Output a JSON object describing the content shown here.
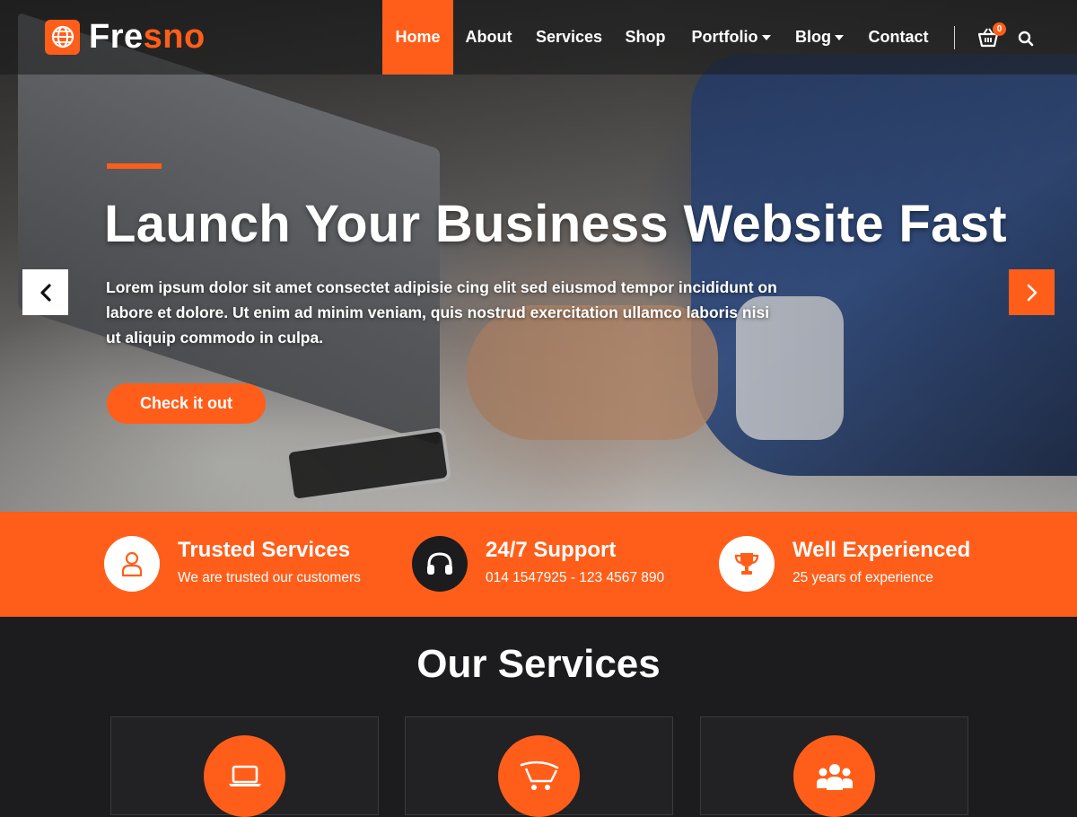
{
  "brand": {
    "name_part1": "Fre",
    "name_part2": "sno",
    "accent_color": "#ff5e1a"
  },
  "nav": {
    "items": [
      {
        "label": "Home",
        "active": true
      },
      {
        "label": "About"
      },
      {
        "label": "Services"
      },
      {
        "label": "Shop"
      },
      {
        "label": "Portfolio",
        "dropdown": true
      },
      {
        "label": "Blog",
        "dropdown": true
      },
      {
        "label": "Contact"
      }
    ],
    "cart_count": "0",
    "icons": [
      "cart-icon",
      "search-icon"
    ]
  },
  "hero": {
    "title": "Launch Your Business Website Fast",
    "text": "Lorem ipsum dolor sit amet consectet adipisie cing elit sed eiusmod tempor incididunt on labore et dolore. Ut enim ad minim veniam, quis nostrud exercitation ullamco laboris nisi ut aliquip commodo in culpa.",
    "button": "Check it out"
  },
  "features": [
    {
      "title": "Trusted Services",
      "subtitle": "We are trusted our customers",
      "icon": "user-icon"
    },
    {
      "title": "24/7 Support",
      "subtitle": "014 1547925 - 123 4567 890",
      "icon": "headphones-icon"
    },
    {
      "title": "Well Experienced",
      "subtitle": "25 years of experience",
      "icon": "trophy-icon"
    }
  ],
  "services": {
    "title": "Our Services",
    "cards": [
      {
        "icon": "laptop-icon"
      },
      {
        "icon": "shopping-cart-icon"
      },
      {
        "icon": "users-icon"
      }
    ]
  }
}
